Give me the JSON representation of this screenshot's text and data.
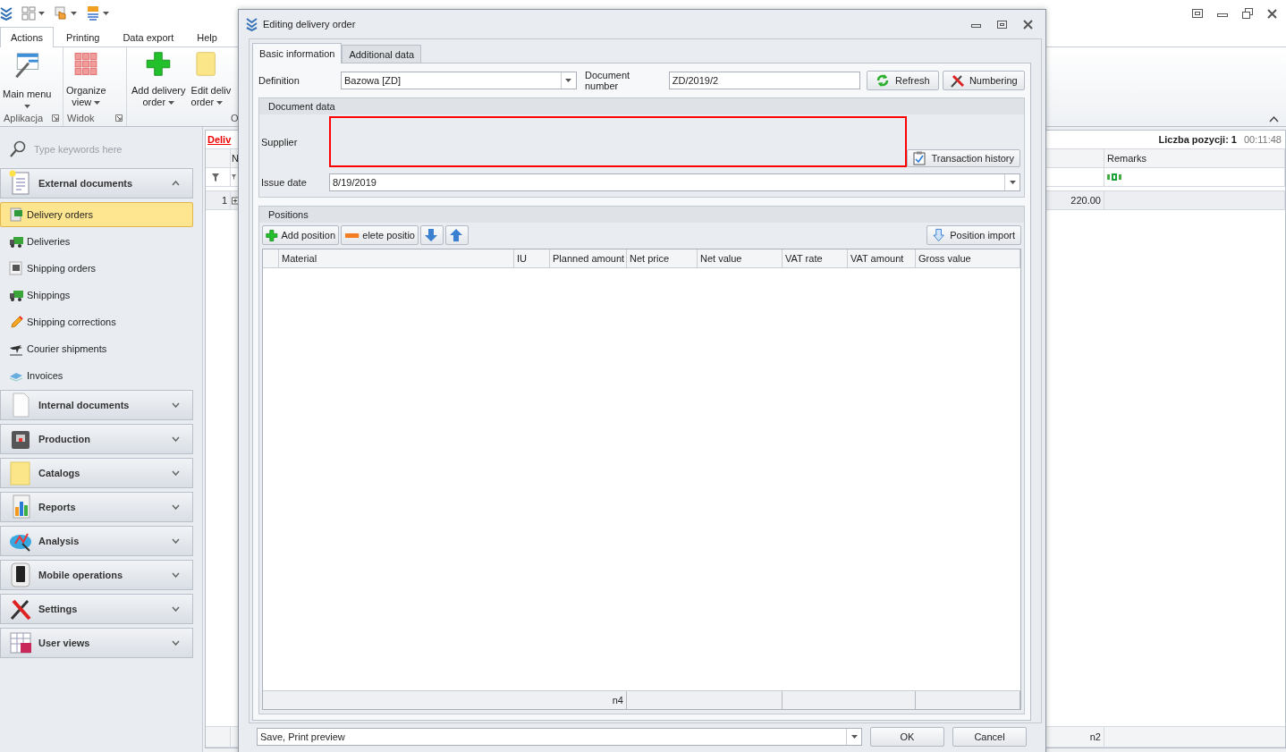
{
  "ribbon": {
    "tabs": [
      {
        "label": "Actions",
        "selected": true
      },
      {
        "label": "Printing",
        "selected": false
      },
      {
        "label": "Data export",
        "selected": false
      },
      {
        "label": "Help",
        "selected": false
      }
    ],
    "groups": [
      {
        "label": "Aplikacja",
        "launcher": true,
        "buttons": [
          {
            "kind": "menu",
            "lines": [
              "Main menu"
            ],
            "dropdown": true
          }
        ]
      },
      {
        "label": "Widok",
        "launcher": true,
        "buttons": [
          {
            "kind": "grid",
            "lines": [
              "Organize",
              "view"
            ],
            "dropdown": true
          }
        ]
      },
      {
        "label": "O",
        "launcher": false,
        "buttons": [
          {
            "kind": "add",
            "lines": [
              "Add delivery",
              "order"
            ],
            "dropdown": true
          },
          {
            "kind": "folder",
            "lines": [
              "Edit deliv",
              "order"
            ],
            "dropdown": true
          }
        ]
      }
    ]
  },
  "sidebar": {
    "search_placeholder": "Type keywords here",
    "groups": [
      {
        "kind": "external",
        "label": "External documents",
        "expanded": true,
        "items": [
          {
            "kind": "order",
            "label": "Delivery orders",
            "selected": true
          },
          {
            "kind": "truck",
            "label": "Deliveries",
            "selected": false
          },
          {
            "kind": "box",
            "label": "Shipping orders",
            "selected": false
          },
          {
            "kind": "truck",
            "label": "Shippings",
            "selected": false
          },
          {
            "kind": "pencil",
            "label": "Shipping corrections",
            "selected": false
          },
          {
            "kind": "plane",
            "label": "Courier shipments",
            "selected": false
          },
          {
            "kind": "stack",
            "label": "Invoices",
            "selected": false
          }
        ]
      },
      {
        "kind": "internal",
        "label": "Internal documents",
        "expanded": false
      },
      {
        "kind": "production",
        "label": "Production",
        "expanded": false
      },
      {
        "kind": "catalogs",
        "label": "Catalogs",
        "expanded": false
      },
      {
        "kind": "reports",
        "label": "Reports",
        "expanded": false
      },
      {
        "kind": "analysis",
        "label": "Analysis",
        "expanded": false
      },
      {
        "kind": "mobile",
        "label": "Mobile operations",
        "expanded": false
      },
      {
        "kind": "settings",
        "label": "Settings",
        "expanded": false
      },
      {
        "kind": "views",
        "label": "User views",
        "expanded": false
      }
    ]
  },
  "list": {
    "title": "Deliv",
    "summary": "Liczba pozycji: 1",
    "time": "00:11:48",
    "columns": [
      "N",
      "Remarks"
    ],
    "rows": [
      {
        "number": "1",
        "expandable": true,
        "column_4": "220.00"
      }
    ],
    "footer": "n2"
  },
  "dialog": {
    "title": "Editing delivery order",
    "tabs": [
      {
        "label": "Basic information",
        "selected": true
      },
      {
        "label": "Additional data",
        "selected": false
      }
    ],
    "definition": {
      "label": "Definition",
      "value": "Bazowa [ZD]"
    },
    "document_number": {
      "label": "Document number",
      "value": "ZD/2019/2"
    },
    "buttons": [
      {
        "kind": "refresh",
        "label": "Refresh"
      },
      {
        "kind": "numbering",
        "label": "Numbering"
      }
    ],
    "document_data": {
      "title": "Document data",
      "supplier": {
        "label": "Supplier",
        "invalid": true
      },
      "transaction_history": "Transaction history",
      "issue_date": {
        "label": "Issue date",
        "value": "8/19/2019"
      }
    },
    "positions": {
      "title": "Positions",
      "toolbar": [
        {
          "kind": "add",
          "label": "Add position"
        },
        {
          "kind": "delete",
          "label": "elete positio"
        },
        {
          "kind": "down"
        },
        {
          "kind": "up"
        }
      ],
      "import": "Position import",
      "columns": [
        "Material",
        "IU",
        "Planned amount",
        "Net price",
        "Net value",
        "VAT rate",
        "VAT amount",
        "Gross value"
      ],
      "footer": "n4"
    },
    "action": "Save, Print preview",
    "ok": "OK",
    "cancel": "Cancel"
  }
}
